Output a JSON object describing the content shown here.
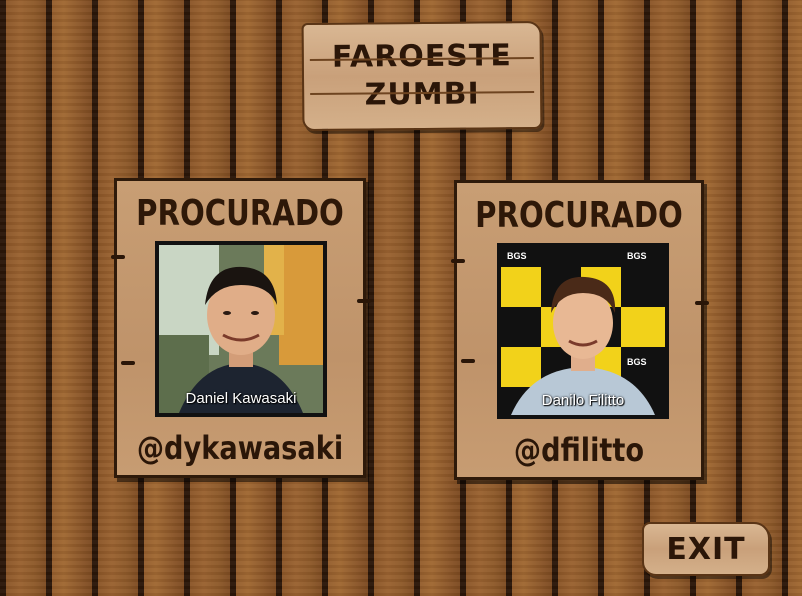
{
  "game": {
    "title": "FAROESTE\nZUMBI",
    "exit_label": "EXIT"
  },
  "posters": [
    {
      "heading": "PROCURADO",
      "photo_caption": "Daniel Kawasaki",
      "handle": "@dykawasaki"
    },
    {
      "heading": "PROCURADO",
      "photo_caption": "Danilo Filitto",
      "handle": "@dfilitto"
    }
  ],
  "colors": {
    "wood_dark": "#2a1608",
    "wood_mid": "#8b5628",
    "parchment": "#c89e74",
    "ink": "#2b1608"
  }
}
